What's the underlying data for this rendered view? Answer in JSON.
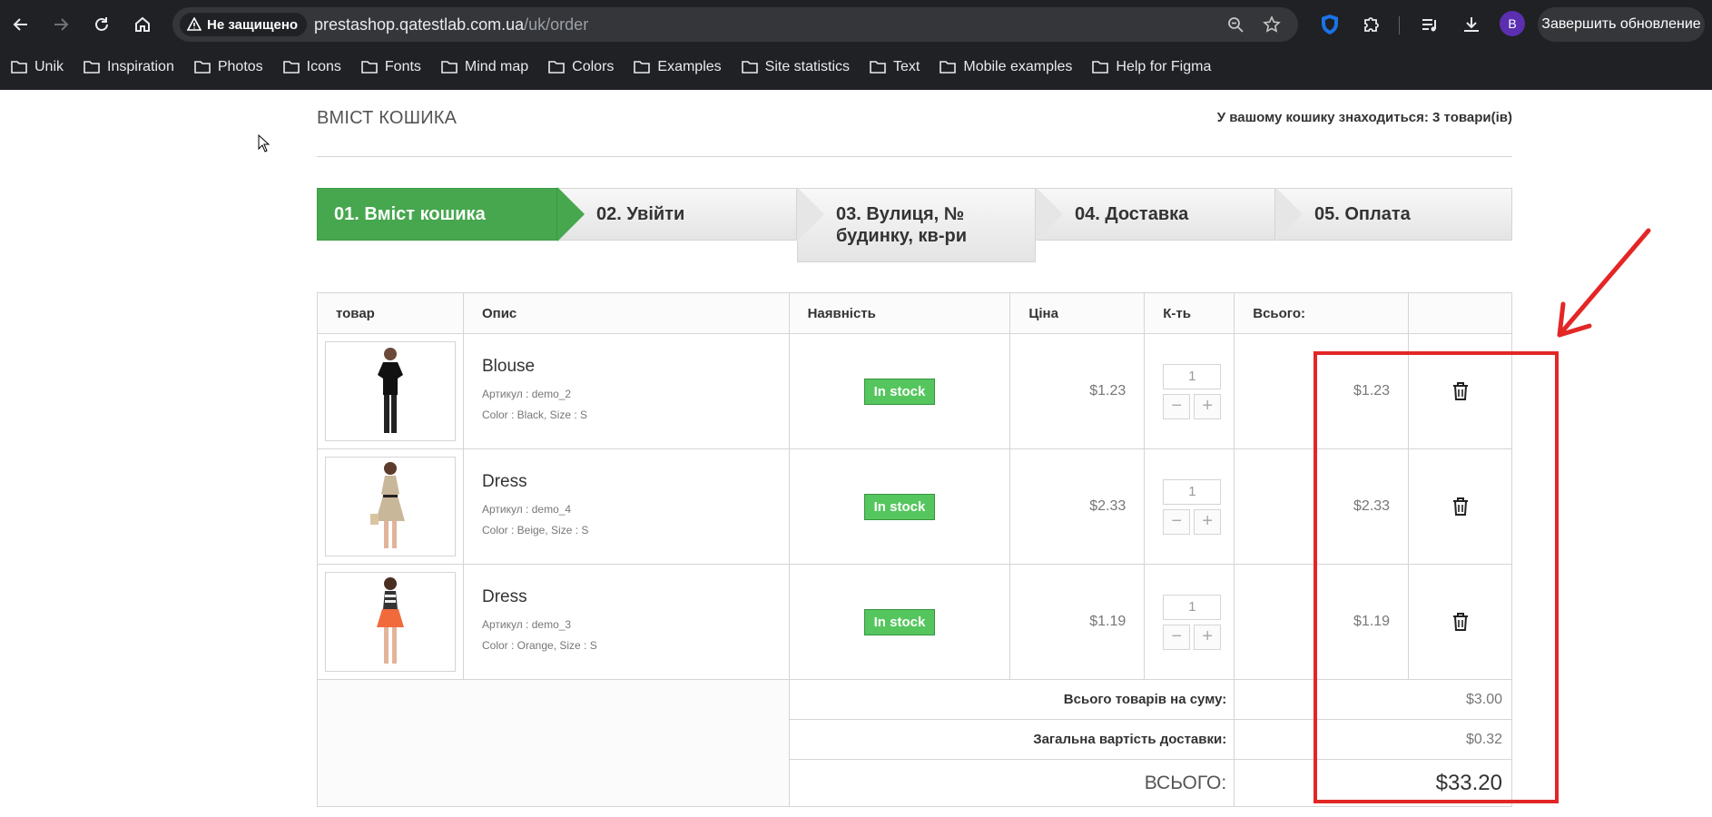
{
  "browser": {
    "security_label": "Не защищено",
    "url_host": "prestashop.qatestlab.com.ua",
    "url_path": "/uk/order",
    "profile_initial": "B",
    "update_button": "Завершить обновление",
    "bookmarks": [
      "Unik",
      "Inspiration",
      "Photos",
      "Icons",
      "Fonts",
      "Mind map",
      "Colors",
      "Examples",
      "Site statistics",
      "Text",
      "Mobile examples",
      "Help for Figma"
    ]
  },
  "page": {
    "heading": "Вміст кошика",
    "cart_count": "У вашому кошику знаходиться: 3 товари(ів)"
  },
  "steps": [
    {
      "label": "01. Вміст кошика"
    },
    {
      "label": "02. Увійти"
    },
    {
      "label": "03. Вулиця, № будинку, кв-ри"
    },
    {
      "label": "04. Доставка"
    },
    {
      "label": "05. Оплата"
    }
  ],
  "table": {
    "headers": [
      "товар",
      "Опис",
      "Наявність",
      "Ціна",
      "К-ть",
      "Всього:"
    ],
    "rows": [
      {
        "name": "Blouse",
        "sku": "Артикул : demo_2",
        "attrs": "Color : Black, Size : S",
        "stock": "In stock",
        "price": "$1.23",
        "qty": "1",
        "total": "$1.23",
        "dress_color": "#111111"
      },
      {
        "name": "Dress",
        "sku": "Артикул : demo_4",
        "attrs": "Color : Beige, Size : S",
        "stock": "In stock",
        "price": "$2.33",
        "qty": "1",
        "total": "$2.33",
        "dress_color": "#c9b79a"
      },
      {
        "name": "Dress",
        "sku": "Артикул : demo_3",
        "attrs": "Color : Orange, Size : S",
        "stock": "In stock",
        "price": "$1.19",
        "qty": "1",
        "total": "$1.19",
        "dress_color": "#f06a3c"
      }
    ],
    "summary": {
      "products_label": "Всього товарів на суму:",
      "products_value": "$3.00",
      "shipping_label": "Загальна вартість доставки:",
      "shipping_value": "$0.32",
      "total_label": "Всього:",
      "total_value": "$33.20"
    }
  },
  "colors": {
    "active_step": "#46a74e",
    "in_stock": "#55c65e",
    "annotation": "#e32626"
  }
}
